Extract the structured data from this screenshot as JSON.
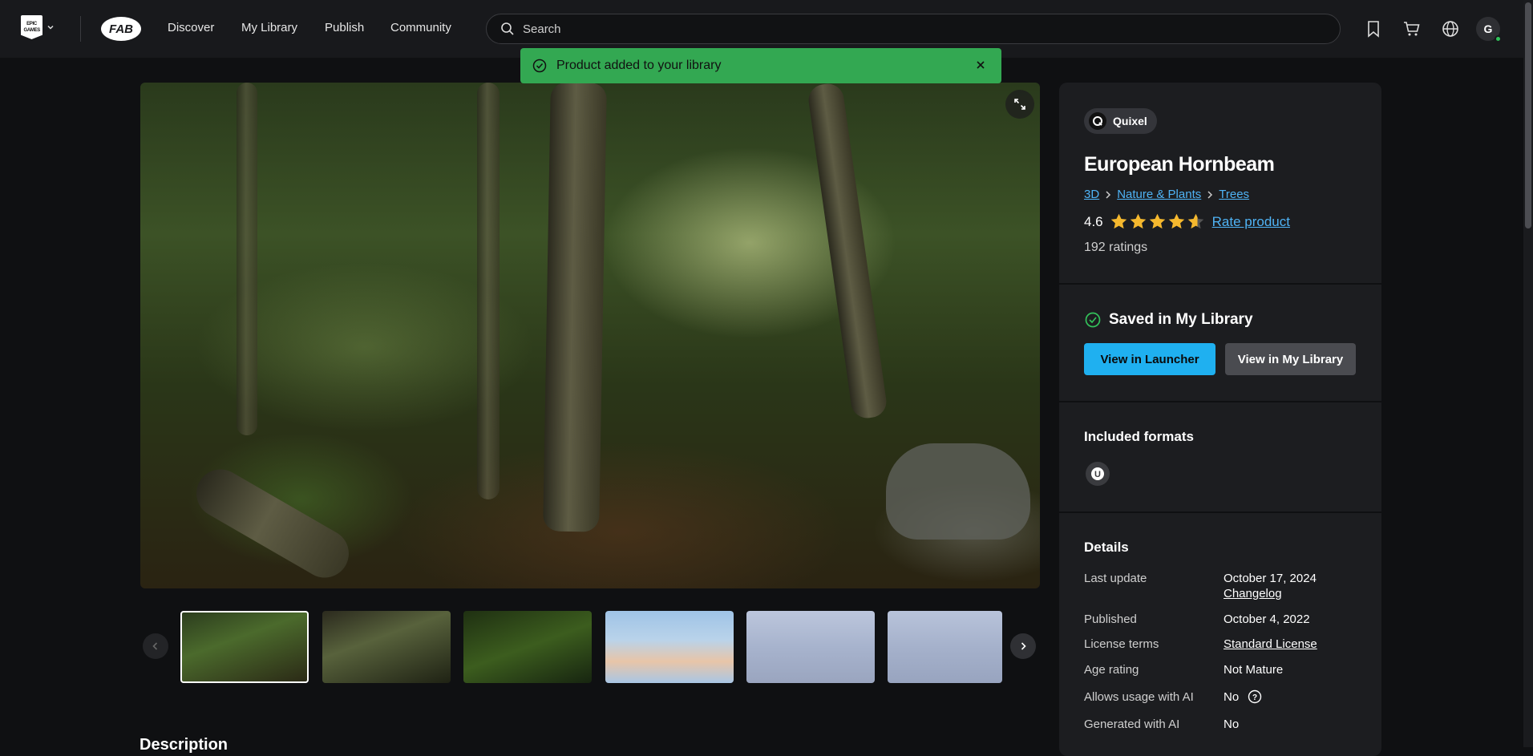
{
  "header": {
    "logo_text": "EPIC GAMES",
    "nav": [
      "Discover",
      "My Library",
      "Publish",
      "Community"
    ],
    "search_placeholder": "Search",
    "avatar_initial": "G"
  },
  "toast": {
    "message": "Product added to your library"
  },
  "product": {
    "seller": "Quixel",
    "title": "European Hornbeam",
    "breadcrumb": [
      "3D",
      "Nature & Plants",
      "Trees"
    ],
    "rating": "4.6",
    "rating_value": 4.6,
    "rate_label": "Rate product",
    "ratings_count": "192 ratings",
    "saved_label": "Saved in My Library",
    "btn_launcher": "View in Launcher",
    "btn_library": "View in My Library",
    "formats_heading": "Included formats",
    "details_heading": "Details",
    "details": {
      "last_update_label": "Last update",
      "last_update_value": "October 17, 2024",
      "changelog": "Changelog",
      "published_label": "Published",
      "published_value": "October 4, 2022",
      "license_label": "License terms",
      "license_value": "Standard License",
      "age_label": "Age rating",
      "age_value": "Not Mature",
      "ai_usage_label": "Allows usage with AI",
      "ai_usage_value": "No",
      "ai_generated_label": "Generated with AI",
      "ai_generated_value": "No"
    }
  },
  "description_heading": "Description",
  "colors": {
    "accent": "#1fb0f0",
    "success": "#33a852",
    "link": "#4fb3f5",
    "star": "#f5b82e"
  }
}
